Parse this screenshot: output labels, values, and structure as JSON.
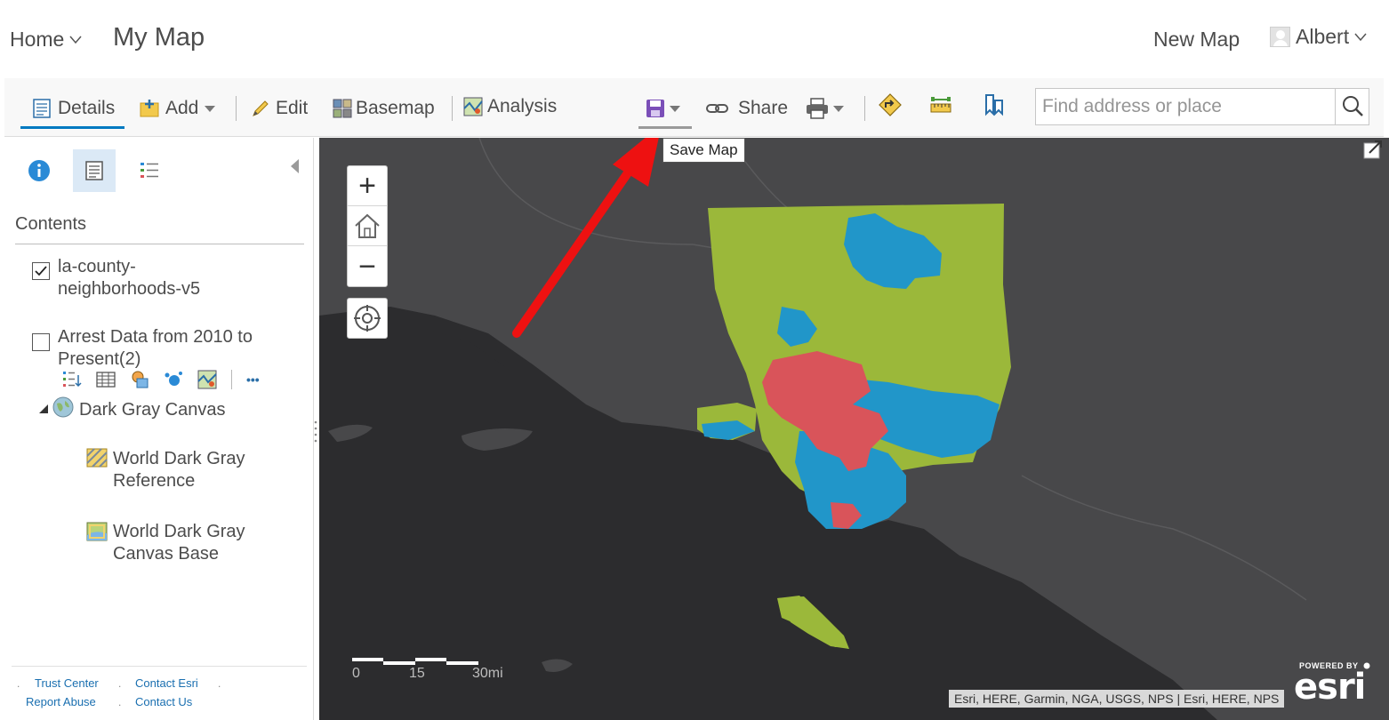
{
  "header": {
    "home_label": "Home",
    "map_title": "My Map",
    "new_map_label": "New Map",
    "user_name": "Albert"
  },
  "toolbar": {
    "details_label": "Details",
    "add_label": "Add",
    "edit_label": "Edit",
    "basemap_label": "Basemap",
    "analysis_label": "Analysis",
    "share_label": "Share",
    "search_placeholder": "Find address or place"
  },
  "tooltip": {
    "save_map": "Save Map"
  },
  "panel": {
    "contents_title": "Contents",
    "layers": [
      {
        "label": "la-county-neighborhoods-v5",
        "line1": "la-county-",
        "line2": "neighborhoods-v5",
        "checked": true
      },
      {
        "label": "Arrest Data from 2010 to Present(2)",
        "line1": "Arrest Data from 2010 to",
        "line2": "Present(2)",
        "checked": false
      }
    ],
    "basemap_group": "Dark Gray Canvas",
    "basemap_layers": [
      {
        "line1": "World Dark Gray",
        "line2": "Reference"
      },
      {
        "line1": "World Dark Gray",
        "line2": "Canvas Base"
      }
    ],
    "more_label": "•••",
    "footer": {
      "trust_center": "Trust Center",
      "contact_esri": "Contact Esri",
      "report_abuse": "Report Abuse",
      "contact_us": "Contact Us"
    }
  },
  "map": {
    "scale_labels": [
      "0",
      "15",
      "30mi"
    ],
    "attribution": "Esri, HERE, Garmin, NGA, USGS, NPS | Esri, HERE, NPS",
    "logo_powered": "POWERED BY",
    "logo_brand": "esri",
    "zoom_in": "+",
    "zoom_out": "−"
  },
  "colors": {
    "accent": "#0079c1",
    "region_green": "#9bb83a",
    "region_blue": "#2196c9",
    "region_red": "#d9545a",
    "annotation_arrow": "#ee1111"
  },
  "icons": [
    "caret-down-icon",
    "details-icon",
    "add-icon",
    "edit-icon",
    "basemap-icon",
    "analysis-icon",
    "save-icon",
    "share-icon",
    "print-icon",
    "directions-icon",
    "measure-icon",
    "bookmarks-icon",
    "search-icon",
    "info-icon",
    "legend-icon",
    "home-icon",
    "locate-icon"
  ]
}
